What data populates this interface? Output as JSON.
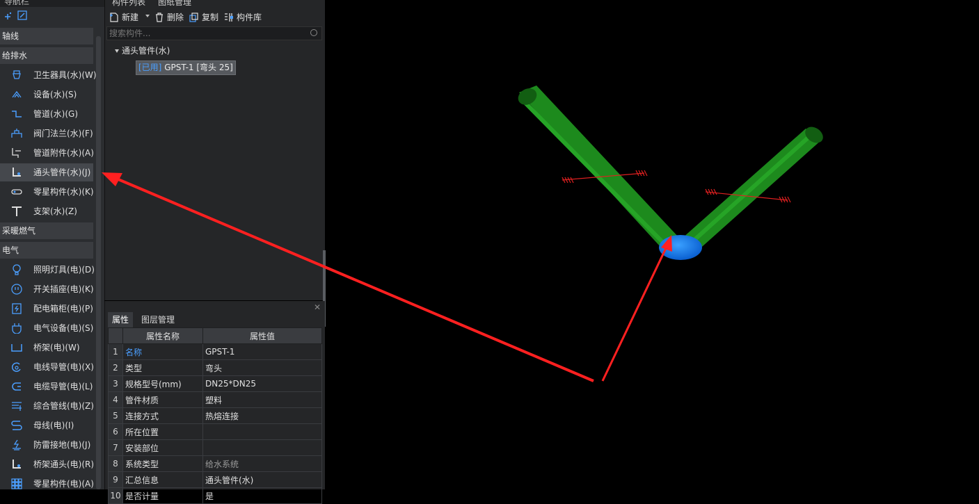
{
  "nav": {
    "header": "导航栏",
    "groups": {
      "axis": "轴线",
      "plumbing": "给排水",
      "hvac": "采暖燃气",
      "electrical": "电气"
    },
    "plumbing_items": [
      {
        "label": "卫生器具(水)(W)",
        "icon": "sanitary-fixture-icon"
      },
      {
        "label": "设备(水)(S)",
        "icon": "equipment-icon"
      },
      {
        "label": "管道(水)(G)",
        "icon": "pipe-icon"
      },
      {
        "label": "阀门法兰(水)(F)",
        "icon": "valve-flange-icon"
      },
      {
        "label": "管道附件(水)(A)",
        "icon": "pipe-accessory-icon"
      },
      {
        "label": "通头管件(水)(J)",
        "icon": "pipe-fitting-icon"
      },
      {
        "label": "零星构件(水)(K)",
        "icon": "misc-component-icon"
      },
      {
        "label": "支架(水)(Z)",
        "icon": "support-icon"
      }
    ],
    "electrical_items": [
      {
        "label": "照明灯具(电)(D)",
        "icon": "lighting-icon"
      },
      {
        "label": "开关插座(电)(K)",
        "icon": "switch-socket-icon"
      },
      {
        "label": "配电箱柜(电)(P)",
        "icon": "distribution-box-icon"
      },
      {
        "label": "电气设备(电)(S)",
        "icon": "electrical-equipment-icon"
      },
      {
        "label": "桥架(电)(W)",
        "icon": "cable-tray-icon"
      },
      {
        "label": "电线导管(电)(X)",
        "icon": "wire-conduit-icon"
      },
      {
        "label": "电缆导管(电)(L)",
        "icon": "cable-conduit-icon"
      },
      {
        "label": "综合管线(电)(Z)",
        "icon": "combined-pipeline-icon"
      },
      {
        "label": "母线(电)(I)",
        "icon": "busbar-icon"
      },
      {
        "label": "防雷接地(电)(J)",
        "icon": "lightning-grounding-icon"
      },
      {
        "label": "桥架通头(电)(R)",
        "icon": "tray-fitting-icon"
      },
      {
        "label": "零星构件(电)(A)",
        "icon": "misc-component-elec-icon"
      }
    ]
  },
  "component_panel": {
    "tabs": [
      "构件列表",
      "图纸管理"
    ],
    "toolbar": {
      "new": "新建",
      "delete": "删除",
      "copy": "复制",
      "library": "构件库"
    },
    "search_placeholder": "搜索构件...",
    "tree_root": "通头管件(水)",
    "tree_leaf_status": "[已用]",
    "tree_leaf_name": "GPST-1 [弯头 25]"
  },
  "property_panel": {
    "tabs": [
      "属性",
      "图层管理"
    ],
    "headers": [
      "属性名称",
      "属性值"
    ],
    "rows": [
      {
        "num": "1",
        "name": "名称",
        "value": "GPST-1"
      },
      {
        "num": "2",
        "name": "类型",
        "value": "弯头"
      },
      {
        "num": "3",
        "name": "规格型号(mm)",
        "value": "DN25*DN25"
      },
      {
        "num": "4",
        "name": "管件材质",
        "value": "塑料"
      },
      {
        "num": "5",
        "name": "连接方式",
        "value": "热熔连接"
      },
      {
        "num": "6",
        "name": "所在位置",
        "value": ""
      },
      {
        "num": "7",
        "name": "安装部位",
        "value": ""
      },
      {
        "num": "8",
        "name": "系统类型",
        "value": "给水系统"
      },
      {
        "num": "9",
        "name": "汇总信息",
        "value": "通头管件(水)"
      },
      {
        "num": "10",
        "name": "是否计量",
        "value": "是"
      }
    ]
  },
  "colors": {
    "accent_blue": "#4b9fff",
    "pipe_green": "#1e8a1e",
    "elbow_blue": "#1e7fff",
    "annotation_red": "#ff2020"
  }
}
